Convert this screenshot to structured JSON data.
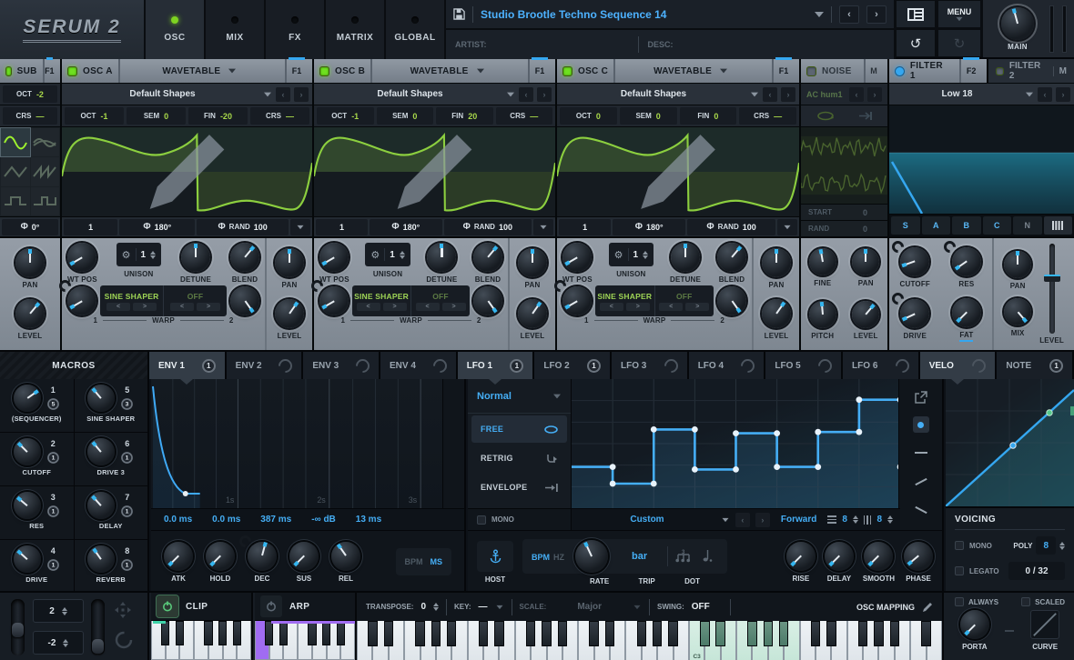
{
  "header": {
    "logo": "SERUM 2",
    "tabs": [
      {
        "label": "OSC",
        "active": true
      },
      {
        "label": "MIX",
        "active": false
      },
      {
        "label": "FX",
        "active": false
      },
      {
        "label": "MATRIX",
        "active": false
      },
      {
        "label": "GLOBAL",
        "active": false
      }
    ],
    "preset": {
      "name": "Studio Brootle Techno Sequence 14",
      "artist_label": "ARTIST:",
      "desc_label": "DESC:"
    },
    "menu_label": "MENU",
    "main_label": "MAIN"
  },
  "labels": {
    "oct": "OCT",
    "sem": "SEM",
    "fin": "FIN",
    "crs": "CRS",
    "wt_pos": "WT POS",
    "unison": "UNISON",
    "detune": "DETUNE",
    "blend": "BLEND",
    "pan": "PAN",
    "level": "LEVEL",
    "warp": "WARP",
    "rand": "RAND",
    "phi": "Φ"
  },
  "sub": {
    "title": "SUB",
    "f_chip": "F1",
    "oct": "-2",
    "crs": "—",
    "phase": "0°",
    "pan": "PAN",
    "level": "LEVEL"
  },
  "oscillators": [
    {
      "title": "OSC A",
      "type": "WAVETABLE",
      "f_chip": "F1",
      "shape": "Default Shapes",
      "oct": "-1",
      "sem": "0",
      "fin": "-20",
      "crs": "—",
      "wt_index": "1",
      "phase": "180°",
      "rand": "100",
      "unison_count": "1",
      "warp1": "SINE SHAPER",
      "warp2": "OFF",
      "warp1_num": "1",
      "warp2_num": "2"
    },
    {
      "title": "OSC B",
      "type": "WAVETABLE",
      "f_chip": "F1",
      "shape": "Default Shapes",
      "oct": "-1",
      "sem": "0",
      "fin": "20",
      "crs": "—",
      "wt_index": "1",
      "phase": "180°",
      "rand": "100",
      "unison_count": "1",
      "warp1": "SINE SHAPER",
      "warp2": "OFF",
      "warp1_num": "1",
      "warp2_num": "2"
    },
    {
      "title": "OSC C",
      "type": "WAVETABLE",
      "f_chip": "F1",
      "shape": "Default Shapes",
      "oct": "0",
      "sem": "0",
      "fin": "0",
      "crs": "—",
      "wt_index": "1",
      "phase": "180°",
      "rand": "100",
      "unison_count": "1",
      "warp1": "SINE SHAPER",
      "warp2": "OFF",
      "warp1_num": "1",
      "warp2_num": "2"
    }
  ],
  "noise": {
    "title": "NOISE",
    "mute": "M",
    "sample": "AC hum1",
    "start_label": "START",
    "start_value": "0",
    "rand_label": "RAND",
    "rand_value": "0",
    "knobs": [
      "FINE",
      "PAN",
      "PITCH",
      "LEVEL"
    ]
  },
  "filter": {
    "title": "FILTER 1",
    "f_chip": "F2",
    "tab2": "FILTER 2",
    "mute": "M",
    "type": "Low 18",
    "routing": [
      "S",
      "A",
      "B",
      "C",
      "N"
    ],
    "knobs": [
      "CUTOFF",
      "RES",
      "DRIVE",
      "FAT"
    ],
    "pan": "PAN",
    "mix": "MIX",
    "level": "LEVEL"
  },
  "mod": {
    "macros_title": "MACROS",
    "tabs": [
      {
        "label": "ENV 1",
        "badge": "1",
        "active": true
      },
      {
        "label": "ENV 2",
        "badge": ""
      },
      {
        "label": "ENV 3",
        "badge": ""
      },
      {
        "label": "ENV 4",
        "badge": ""
      },
      {
        "label": "LFO 1",
        "badge": "1",
        "active": true
      },
      {
        "label": "LFO 2",
        "badge": "1"
      },
      {
        "label": "LFO 3",
        "badge": ""
      },
      {
        "label": "LFO 4",
        "badge": ""
      },
      {
        "label": "LFO 5",
        "badge": ""
      },
      {
        "label": "LFO 6",
        "badge": ""
      },
      {
        "label": "VELO",
        "badge": "",
        "active": true
      },
      {
        "label": "NOTE",
        "badge": "1"
      }
    ]
  },
  "macros": [
    {
      "num": "1",
      "label": "(SEQUENCER)",
      "badge": "5"
    },
    {
      "num": "5",
      "label": "SINE SHAPER",
      "badge": "3"
    },
    {
      "num": "2",
      "label": "CUTOFF",
      "badge": "1"
    },
    {
      "num": "6",
      "label": "DRIVE 3",
      "badge": "1"
    },
    {
      "num": "3",
      "label": "RES",
      "badge": "1"
    },
    {
      "num": "7",
      "label": "DELAY",
      "badge": "1"
    },
    {
      "num": "4",
      "label": "DRIVE",
      "badge": "1"
    },
    {
      "num": "8",
      "label": "REVERB",
      "badge": "1"
    }
  ],
  "env": {
    "ticks": [
      "1s",
      "2s",
      "3s"
    ],
    "values": [
      "0.0 ms",
      "0.0 ms",
      "387 ms",
      "-∞ dB",
      "13 ms"
    ],
    "knobs": [
      "ATK",
      "HOLD",
      "DEC",
      "SUS",
      "REL"
    ],
    "bpm": "BPM",
    "ms": "MS"
  },
  "lfo": {
    "mode": "Normal",
    "opt_free": "FREE",
    "opt_retrig": "RETRIG",
    "opt_envelope": "ENVELOPE",
    "mono": "MONO",
    "shape": "Custom",
    "direction": "Forward",
    "grid_a": "8",
    "grid_b": "8",
    "host": "HOST",
    "bpm": "BPM",
    "hz": "HZ",
    "rate": "RATE",
    "rate_value": "bar",
    "trip": "TRIP",
    "dot": "DOT",
    "knobs": [
      "RISE",
      "DELAY",
      "SMOOTH",
      "PHASE"
    ],
    "steps": [
      0.68,
      0.81,
      0.39,
      0.7,
      0.42,
      0.68,
      0.41,
      0.16
    ]
  },
  "voicing": {
    "title": "VOICING",
    "mono": "MONO",
    "poly_label": "POLY",
    "poly": "8",
    "legato": "LEGATO",
    "voices": "0 / 32"
  },
  "bottom": {
    "bend_up": "2",
    "bend_down": "-2",
    "clip": "CLIP",
    "arp": "ARP",
    "transpose_label": "TRANSPOSE:",
    "transpose": "0",
    "key_label": "KEY:",
    "key": "—",
    "scale_label": "SCALE:",
    "scale": "Major",
    "swing_label": "SWING:",
    "swing": "OFF",
    "osc_mapping": "OSC MAPPING",
    "always": "ALWAYS",
    "scaled": "SCALED",
    "porta": "PORTA",
    "curve": "CURVE",
    "c3": "C3"
  }
}
